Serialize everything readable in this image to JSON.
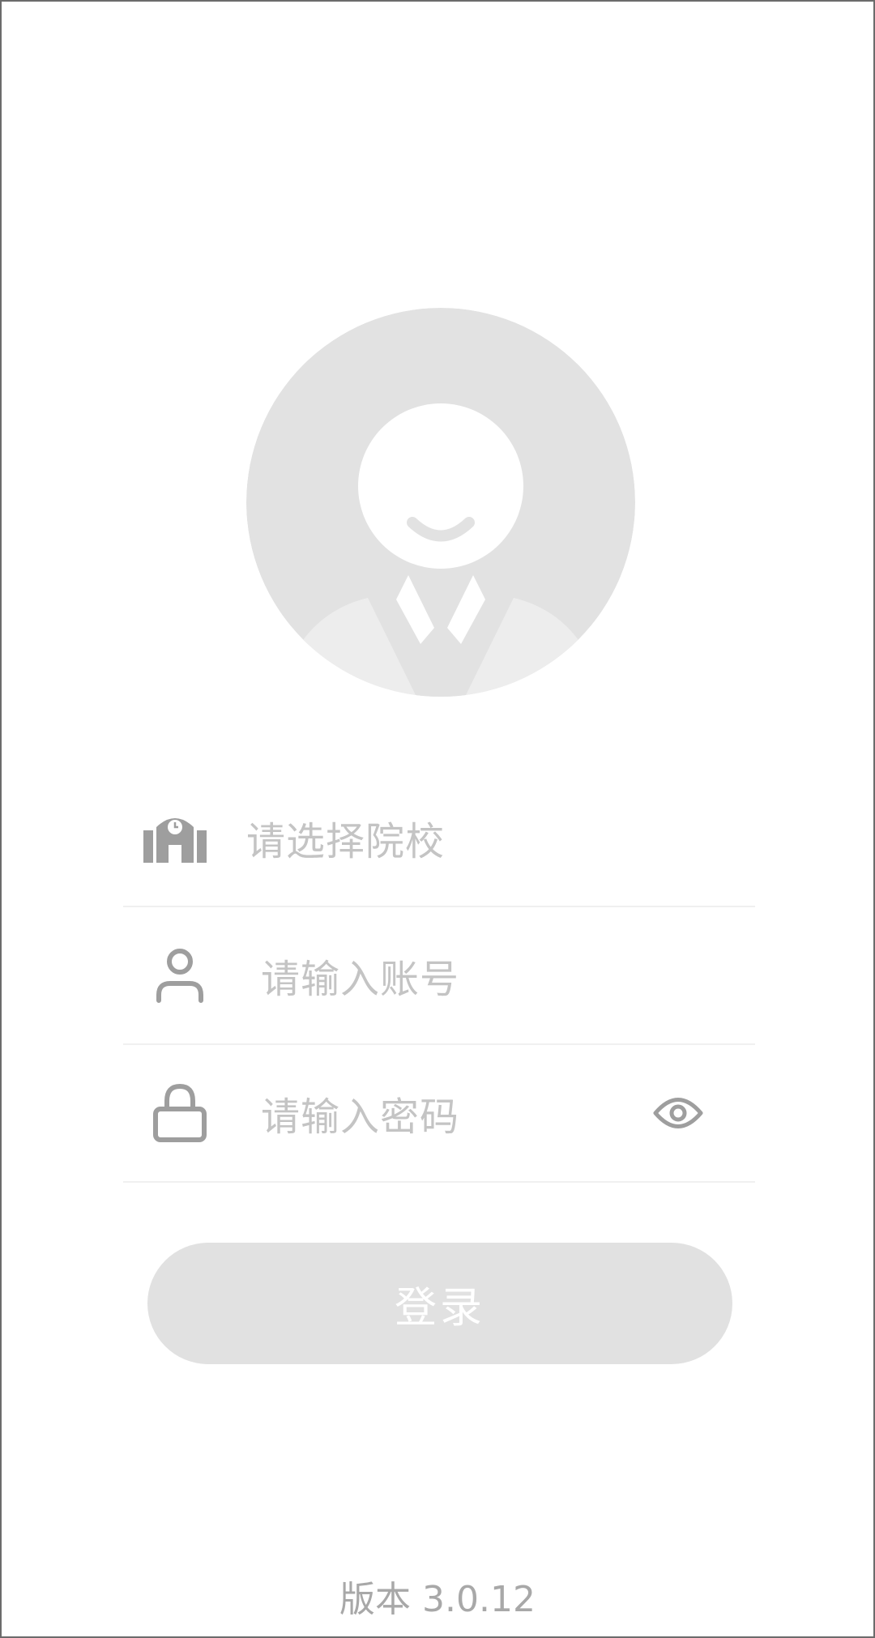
{
  "login_form": {
    "school_placeholder": "请选择院校",
    "account_placeholder": "请输入账号",
    "password_placeholder": "请输入密码",
    "login_label": "登录"
  },
  "icons": {
    "avatar": "default-avatar-icon",
    "school": "school-building-icon",
    "account": "user-icon",
    "password": "lock-icon",
    "toggle_password": "eye-icon"
  },
  "footer": {
    "version": "版本 3.0.12"
  },
  "colors": {
    "placeholder": "#c4c4c4",
    "icon": "#9e9e9e",
    "button_bg": "#e1e1e1",
    "avatar_bg": "#e2e2e2"
  }
}
